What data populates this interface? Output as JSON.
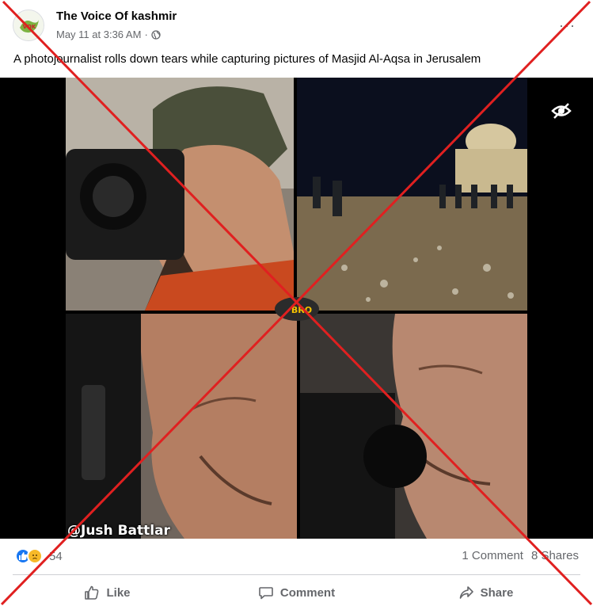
{
  "post": {
    "page_name": "The Voice Of kashmir",
    "timestamp": "May 11 at 3:36 AM",
    "separator": "·",
    "audience_icon": "globe-icon",
    "more_label": "···",
    "caption": "A photojournalist rolls down tears while capturing pictures of Masjid Al-Aqsa in Jerusalem",
    "avatar_text": "VOK"
  },
  "media": {
    "watermark": "@Jush Battlar",
    "sticker_text": "BRO",
    "hide_icon": "eye-slash-icon"
  },
  "stats": {
    "reaction_count": "54",
    "comments": "1 Comment",
    "shares": "8 Shares",
    "reaction_icons": [
      "like-icon",
      "sad-icon"
    ]
  },
  "actions": {
    "like": "Like",
    "comment": "Comment",
    "share": "Share"
  },
  "colors": {
    "accent": "#1877f2",
    "secondary_text": "#65676b",
    "cross": "#e02020"
  }
}
